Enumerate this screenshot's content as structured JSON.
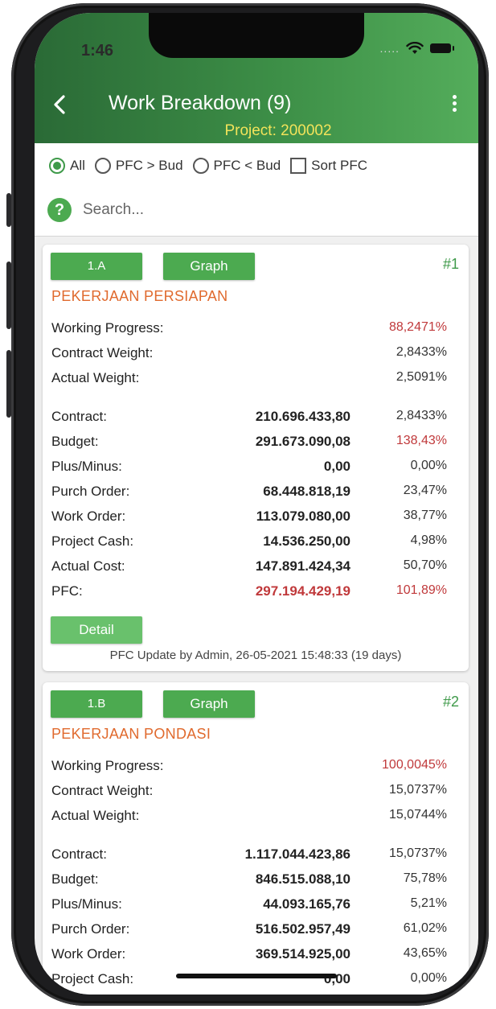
{
  "status": {
    "time": "1:46",
    "carrier_dots": "....."
  },
  "header": {
    "title": "Work Breakdown (9)",
    "project": "Project: 200002"
  },
  "filters": {
    "options": [
      "All",
      "PFC > Bud",
      "PFC < Bud"
    ],
    "checkbox": "Sort PFC",
    "selected": "All"
  },
  "search": {
    "placeholder": "Search..."
  },
  "labels": {
    "working_progress": "Working Progress:",
    "contract_weight": "Contract Weight:",
    "actual_weight": "Actual Weight:",
    "contract": "Contract:",
    "budget": "Budget:",
    "plus_minus": "Plus/Minus:",
    "purch_order": "Purch Order:",
    "work_order": "Work Order:",
    "project_cash": "Project Cash:",
    "actual_cost": "Actual Cost:",
    "pfc": "PFC:",
    "graph": "Graph",
    "detail": "Detail"
  },
  "cards": [
    {
      "code": "1.A",
      "seq": "#1",
      "name": "PEKERJAAN PERSIAPAN",
      "working_progress": "88,2471%",
      "contract_weight": "2,8433%",
      "actual_weight": "2,5091%",
      "contract": {
        "amount": "210.696.433,80",
        "pct": "2,8433%"
      },
      "budget": {
        "amount": "291.673.090,08",
        "pct": "138,43%"
      },
      "plus_minus": {
        "amount": "0,00",
        "pct": "0,00%"
      },
      "purch_order": {
        "amount": "68.448.818,19",
        "pct": "23,47%"
      },
      "work_order": {
        "amount": "113.079.080,00",
        "pct": "38,77%"
      },
      "project_cash": {
        "amount": "14.536.250,00",
        "pct": "4,98%"
      },
      "actual_cost": {
        "amount": "147.891.424,34",
        "pct": "50,70%"
      },
      "pfc": {
        "amount": "297.194.429,19",
        "pct": "101,89%"
      },
      "footer": "PFC Update by Admin, 26-05-2021 15:48:33 (19 days)"
    },
    {
      "code": "1.B",
      "seq": "#2",
      "name": "PEKERJAAN  PONDASI",
      "working_progress": "100,0045%",
      "contract_weight": "15,0737%",
      "actual_weight": "15,0744%",
      "contract": {
        "amount": "1.117.044.423,86",
        "pct": "15,0737%"
      },
      "budget": {
        "amount": "846.515.088,10",
        "pct": "75,78%"
      },
      "plus_minus": {
        "amount": "44.093.165,76",
        "pct": "5,21%"
      },
      "purch_order": {
        "amount": "516.502.957,49",
        "pct": "61,02%"
      },
      "work_order": {
        "amount": "369.514.925,00",
        "pct": "43,65%"
      },
      "project_cash": {
        "amount": "0,00",
        "pct": "0,00%"
      }
    }
  ],
  "colors": {
    "header_green": "#3d8f47",
    "accent_green": "#4caa50",
    "warn_red": "#c0393b",
    "title_orange": "#e06a2e",
    "project_yellow": "#f2e35a"
  }
}
